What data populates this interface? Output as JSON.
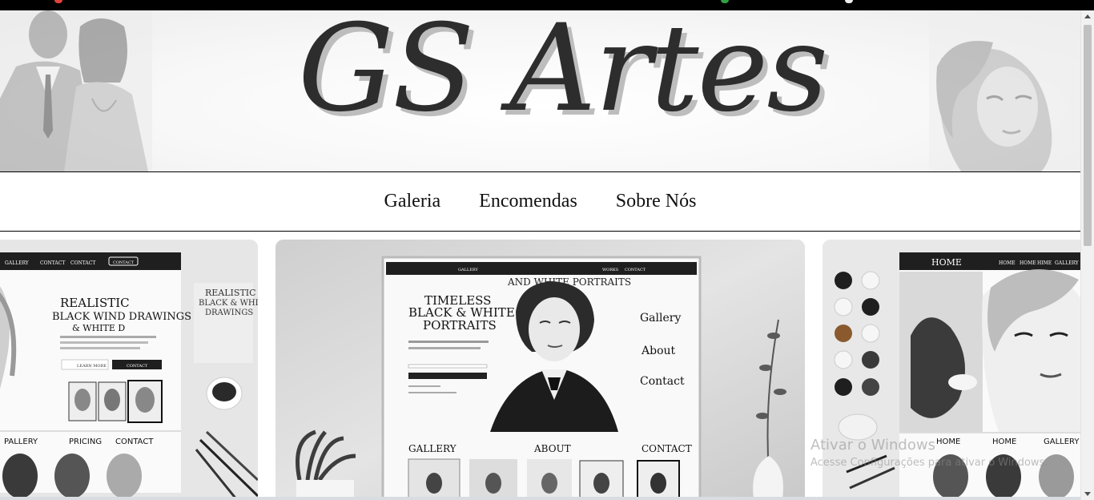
{
  "header": {
    "logo_text": "GS Artes"
  },
  "nav": {
    "items": [
      {
        "label": "Galeria"
      },
      {
        "label": "Encomendas"
      },
      {
        "label": "Sobre Nós"
      }
    ]
  },
  "carousel": {
    "left_slide": {
      "heading_1": "REALISTIC",
      "heading_2": "BLACK WIND DRAWINGS",
      "heading_3": "& WHITE D",
      "side_text_1": "REALISTIC",
      "side_text_2": "BLACK & WHITE",
      "side_text_3": "DRAWINGS",
      "nav_1": "GALLERY",
      "nav_2": "CONTACT",
      "nav_3": "CONTACT",
      "nav_btn": "CONTACT",
      "btn_1": "LEARN MORE",
      "btn_2": "CONTACT",
      "footer_1": "PALLERY",
      "footer_2": "PRICING",
      "footer_3": "CONTACT"
    },
    "center_slide": {
      "top_text": "AND WHITE PORTRAITS",
      "title_1": "TIMELESS",
      "title_2": "BLACK & WHITE",
      "title_3": "PORTRAITS",
      "menu_1": "Gallery",
      "menu_2": "About",
      "menu_3": "Contact",
      "nav_1": "GALLERY",
      "nav_2": "WORKS",
      "nav_3": "CONTACT",
      "sec_1": "GALLERY",
      "sec_2": "ABOUT",
      "sec_3": "CONTACT"
    },
    "right_slide": {
      "brand": "HOME",
      "nav_1": "HOME",
      "nav_2": "HOME",
      "nav_3": "HIME",
      "nav_4": "GALLERY",
      "sec_1": "HOME",
      "sec_2": "HOME",
      "sec_3": "GALLERY"
    }
  },
  "watermark": {
    "line1": "Ativar o Windows",
    "line2": "Acesse Configurações para ativar o Windows."
  }
}
